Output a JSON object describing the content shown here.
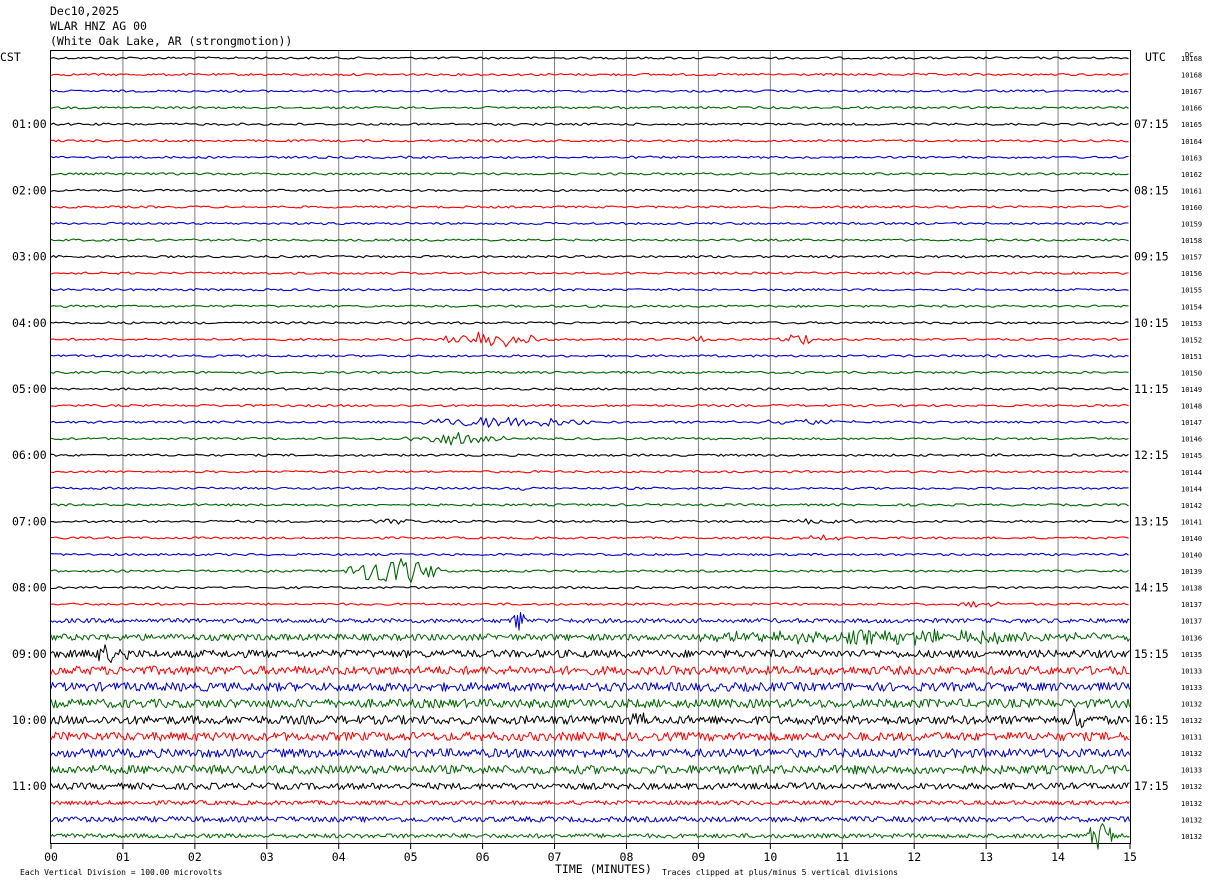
{
  "header": {
    "date": "Dec10,2025",
    "station_line": "WLAR HNZ AG 00",
    "location_line": "(White Oak Lake, AR (strongmotion))"
  },
  "axes": {
    "left_tz": "CST",
    "right_tz": "UTC",
    "dc_label": "DC",
    "xlabel": "TIME (MINUTES)",
    "footer_left": "Each Vertical Division =  100.00 microvolts",
    "footer_right": "Traces clipped at plus/minus 5 vertical divisions"
  },
  "colors": {
    "trace_cycle": [
      "#000000",
      "#ff0000",
      "#0000cc",
      "#006600"
    ],
    "grid": "#808080",
    "text": "#000000"
  },
  "chart_data": {
    "type": "helicorder",
    "x_range": [
      0,
      15
    ],
    "x_ticks": [
      "00",
      "01",
      "02",
      "03",
      "04",
      "05",
      "06",
      "07",
      "08",
      "09",
      "10",
      "11",
      "12",
      "13",
      "14",
      "15"
    ],
    "row_minutes": 15,
    "rows_count": 48,
    "left_hour_labels": [
      "01:00",
      "02:00",
      "03:00",
      "04:00",
      "05:00",
      "06:00",
      "07:00",
      "08:00",
      "09:00",
      "10:00",
      "11:00"
    ],
    "right_hour_labels": [
      "07:15",
      "08:15",
      "09:15",
      "10:15",
      "11:15",
      "12:15",
      "13:15",
      "14:15",
      "15:15",
      "16:15",
      "17:15"
    ],
    "label_rows": [
      4,
      8,
      12,
      16,
      20,
      24,
      28,
      32,
      36,
      40,
      44
    ],
    "dc_offsets": [
      10168,
      10168,
      10167,
      10166,
      10165,
      10164,
      10163,
      10162,
      10161,
      10160,
      10159,
      10158,
      10157,
      10156,
      10155,
      10154,
      10153,
      10152,
      10151,
      10150,
      10149,
      10148,
      10147,
      10146,
      10145,
      10144,
      10144,
      10142,
      10141,
      10140,
      10140,
      10139,
      10138,
      10137,
      10137,
      10136,
      10135,
      10133,
      10133,
      10132,
      10132,
      10131,
      10132,
      10133,
      10132,
      10132,
      10132,
      10132
    ],
    "noise_amplitude_per_row": [
      1,
      1,
      1,
      1,
      1,
      1,
      1,
      1,
      1,
      1,
      1,
      1,
      1,
      1,
      1,
      1,
      1,
      1,
      1,
      1,
      1,
      1,
      1,
      1,
      1,
      1,
      1,
      1,
      1,
      1,
      1,
      1,
      1,
      1,
      2,
      3,
      3.5,
      4,
      4,
      4,
      4,
      4,
      4,
      4,
      3,
      2,
      2.5,
      2
    ],
    "events": [
      {
        "row": 17,
        "start_min": 5.4,
        "end_min": 6.8,
        "peak_divisions": 3
      },
      {
        "row": 17,
        "start_min": 8.9,
        "end_min": 9.1,
        "peak_divisions": 2
      },
      {
        "row": 17,
        "start_min": 10.1,
        "end_min": 10.6,
        "peak_divisions": 2
      },
      {
        "row": 22,
        "start_min": 5.1,
        "end_min": 7.6,
        "peak_divisions": 2
      },
      {
        "row": 22,
        "start_min": 9.4,
        "end_min": 11.2,
        "peak_divisions": 1
      },
      {
        "row": 23,
        "start_min": 4.9,
        "end_min": 6.3,
        "peak_divisions": 2
      },
      {
        "row": 26,
        "start_min": 6.5,
        "end_min": 6.6,
        "peak_divisions": 2
      },
      {
        "row": 28,
        "start_min": 4.4,
        "end_min": 5.2,
        "peak_divisions": 1
      },
      {
        "row": 28,
        "start_min": 10.3,
        "end_min": 11.2,
        "peak_divisions": 1
      },
      {
        "row": 29,
        "start_min": 10.4,
        "end_min": 11.0,
        "peak_divisions": 1
      },
      {
        "row": 31,
        "start_min": 4.1,
        "end_min": 5.4,
        "peak_divisions": 5
      },
      {
        "row": 33,
        "start_min": 12.5,
        "end_min": 13.3,
        "peak_divisions": 1
      },
      {
        "row": 34,
        "start_min": 6.4,
        "end_min": 6.6,
        "peak_divisions": 4
      },
      {
        "row": 35,
        "start_min": 8.6,
        "end_min": 15.0,
        "peak_divisions": 2
      },
      {
        "row": 36,
        "start_min": 0.6,
        "end_min": 1.1,
        "peak_divisions": 3
      },
      {
        "row": 40,
        "start_min": 8.0,
        "end_min": 8.3,
        "peak_divisions": 3
      },
      {
        "row": 40,
        "start_min": 14.1,
        "end_min": 14.4,
        "peak_divisions": 5
      },
      {
        "row": 47,
        "start_min": 14.4,
        "end_min": 14.8,
        "peak_divisions": 5
      }
    ]
  }
}
